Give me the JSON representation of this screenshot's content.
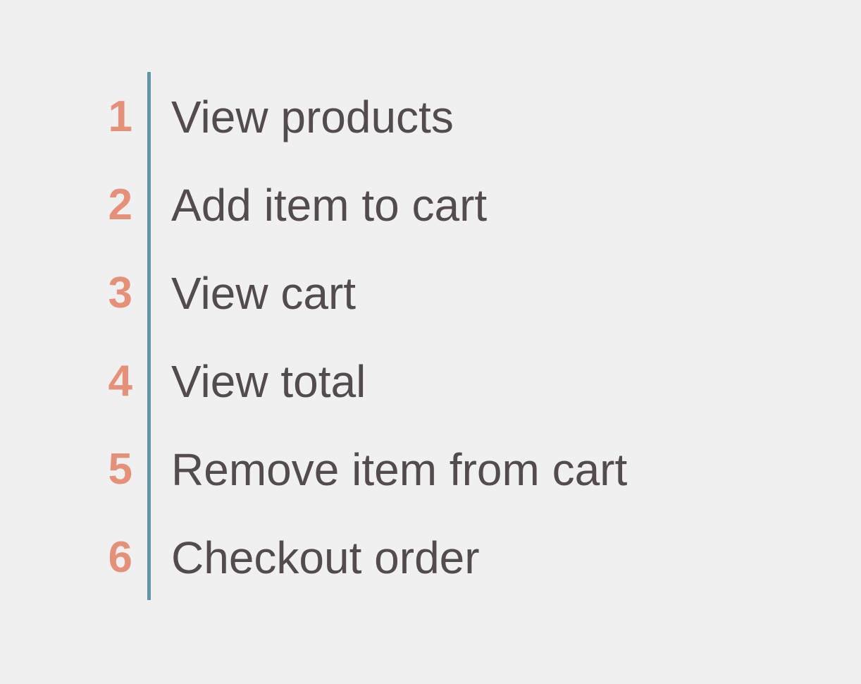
{
  "steps": [
    {
      "number": "1",
      "label": "View products"
    },
    {
      "number": "2",
      "label": "Add item to cart"
    },
    {
      "number": "3",
      "label": "View cart"
    },
    {
      "number": "4",
      "label": "View total"
    },
    {
      "number": "5",
      "label": "Remove item from cart"
    },
    {
      "number": "6",
      "label": "Checkout order"
    }
  ],
  "colors": {
    "background": "#f0f0f0",
    "number": "#e5917a",
    "label": "#544b4e",
    "divider": "#5f95a6"
  }
}
